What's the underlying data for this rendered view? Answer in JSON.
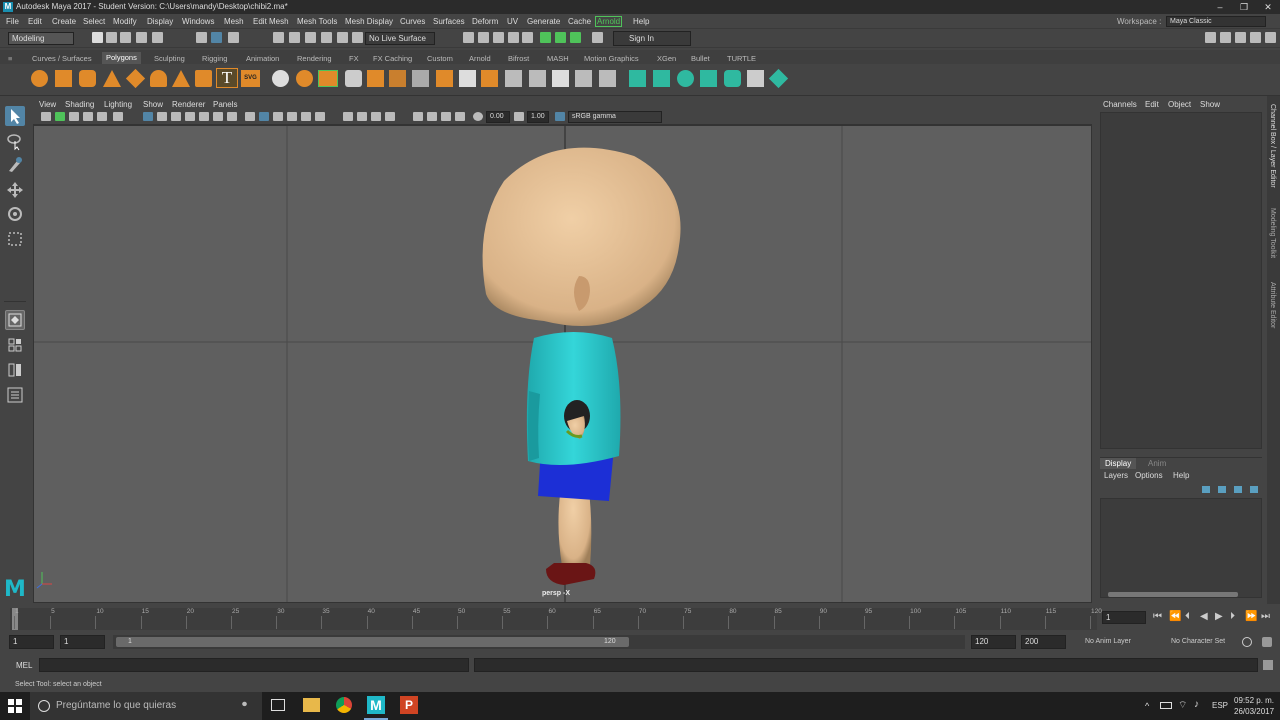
{
  "window": {
    "title": "Autodesk Maya 2017 - Student Version: C:\\Users\\mandy\\Desktop\\chibi2.ma*",
    "minimize": "–",
    "maximize": "❐",
    "close": "✕"
  },
  "menubar": {
    "items": [
      "File",
      "Edit",
      "Create",
      "Select",
      "Modify",
      "Display",
      "Windows",
      "Mesh",
      "Edit Mesh",
      "Mesh Tools",
      "Mesh Display",
      "Curves",
      "Surfaces",
      "Deform",
      "UV",
      "Generate",
      "Cache",
      "Arnold",
      "Help"
    ],
    "workspace_label": "Workspace :",
    "workspace_value": "Maya Classic"
  },
  "statusline": {
    "mode": "Modeling",
    "live_surface": "No Live Surface",
    "sign_in": "Sign In"
  },
  "shelf": {
    "tabs": [
      "Curves / Surfaces",
      "Polygons",
      "Sculpting",
      "Rigging",
      "Animation",
      "Rendering",
      "FX",
      "FX Caching",
      "Custom",
      "Arnold",
      "Bifrost",
      "MASH",
      "Motion Graphics",
      "XGen",
      "Bullet",
      "TURTLE"
    ],
    "active_tab": "Polygons",
    "svg_label": "SVG",
    "text_label": "T"
  },
  "viewport": {
    "menu": [
      "View",
      "Shading",
      "Lighting",
      "Show",
      "Renderer",
      "Panels"
    ],
    "field_a": "0.00",
    "field_b": "1.00",
    "color_space": "sRGB gamma",
    "camera_label": "persp -X"
  },
  "channelbox": {
    "menu": [
      "Channels",
      "Edit",
      "Object",
      "Show"
    ],
    "layer_tabs": [
      "Display",
      "Anim"
    ],
    "layer_menu": [
      "Layers",
      "Options",
      "Help"
    ]
  },
  "sidetabs": [
    "Channel Box / Layer Editor",
    "Modeling Toolkit",
    "Attribute Editor"
  ],
  "timeline": {
    "ticks": [
      "1",
      "5",
      "10",
      "15",
      "20",
      "25",
      "30",
      "35",
      "40",
      "45",
      "50",
      "55",
      "60",
      "65",
      "70",
      "75",
      "80",
      "85",
      "90",
      "95",
      "100",
      "105",
      "110",
      "115",
      "120"
    ],
    "current_frame": "1"
  },
  "range": {
    "start": "1",
    "playback_start": "1",
    "slider_start": "1",
    "slider_end": "120",
    "playback_end": "120",
    "end": "200",
    "anim_layer": "No Anim Layer",
    "character_set": "No Character Set"
  },
  "cmdline": {
    "label": "MEL"
  },
  "helpline": {
    "text": "Select Tool: select an object"
  },
  "taskbar": {
    "search_placeholder": "Pregúntame lo que quieras",
    "lang": "ESP",
    "time": "09:52 p. m.",
    "date": "26/03/2017"
  },
  "colors": {
    "accent": "#5285a6",
    "arnold_green": "#4fc35a",
    "skin": "#e8c39a",
    "shirt": "#29c6c9",
    "shorts": "#1c2fd6",
    "shoe": "#6a1515"
  }
}
